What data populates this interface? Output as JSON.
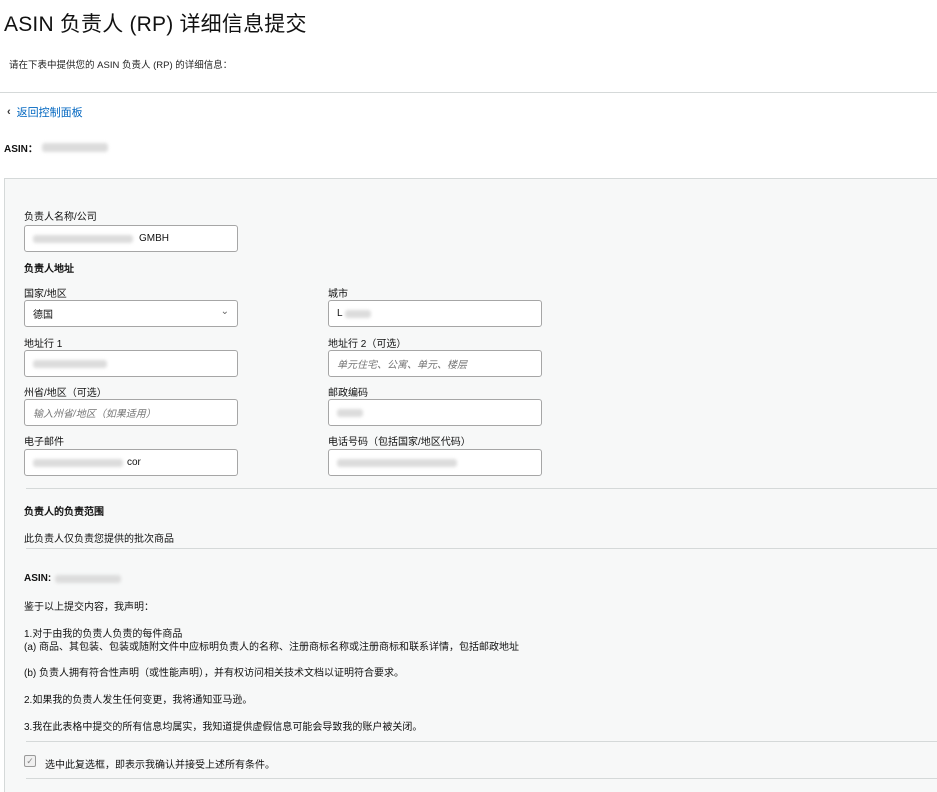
{
  "page": {
    "title": "ASIN 负责人 (RP) 详细信息提交",
    "subtitle": "请在下表中提供您的 ASIN 负责人 (RP) 的详细信息：",
    "back_link": "返回控制面板",
    "asin_label": "ASIN："
  },
  "form": {
    "name_label": "负责人名称/公司",
    "name_value": "GMBH",
    "address_heading": "负责人地址",
    "country_label": "国家/地区",
    "country_value": "德国",
    "city_label": "城市",
    "city_value": "L",
    "address1_label": "地址行 1",
    "address2_label": "地址行 2（可选）",
    "address2_placeholder": "单元住宅、公寓、单元、楼层",
    "state_label": "州省/地区（可选）",
    "state_placeholder": "输入州省/地区（如果适用）",
    "zip_label": "邮政编码",
    "email_label": "电子邮件",
    "email_value_suffix": "cor",
    "phone_label": "电话号码（包括国家/地区代码）"
  },
  "scope": {
    "heading": "负责人的负责范围",
    "text": "此负责人仅负责您提供的批次商品"
  },
  "declaration": {
    "asin_label": "ASIN:",
    "intro": "鉴于以上提交内容，我声明：",
    "item1_title": "1.对于由我的负责人负责的每件商品",
    "item1_a": "(a) 商品、其包装、包装或随附文件中应标明负责人的名称、注册商标名称或注册商标和联系详情，包括邮政地址",
    "item1_b": "(b) 负责人拥有符合性声明（或性能声明），并有权访问相关技术文档以证明符合要求。",
    "item2": "2.如果我的负责人发生任何变更，我将通知亚马逊。",
    "item3": "3.我在此表格中提交的所有信息均属实，我知道提供虚假信息可能会导致我的账户被关闭。",
    "checkbox_label": "选中此复选框，即表示我确认并接受上述所有条件。"
  },
  "icons": {
    "back": "chevron-left-icon",
    "dropdown": "chevron-down-icon",
    "check": "checkmark-icon"
  },
  "colors": {
    "link": "#0066c0",
    "panel_bg": "#f7f8f8",
    "border": "#a6a6a6"
  }
}
